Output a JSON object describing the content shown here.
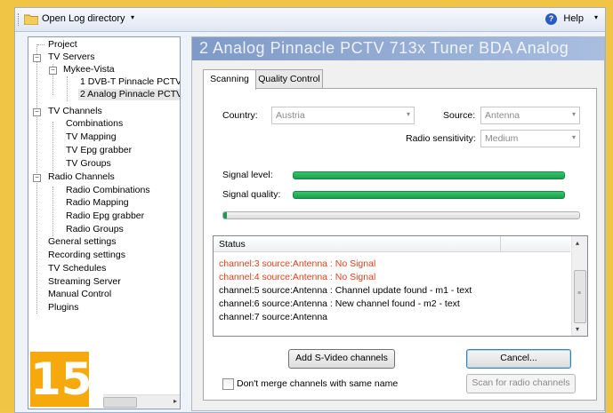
{
  "toolbar": {
    "open_log_label": "Open Log directory",
    "help_label": "Help",
    "caret": "▾"
  },
  "tree": {
    "items": [
      {
        "label": "Project"
      },
      {
        "label": "TV Servers",
        "expander": "−"
      },
      {
        "label": "Mykee-Vista",
        "expander": "−"
      },
      {
        "label": "1 DVB-T Pinnacle PCTV"
      },
      {
        "label": "2 Analog Pinnacle PCTV"
      },
      {
        "label": "TV Channels",
        "expander": "−"
      },
      {
        "label": "Combinations"
      },
      {
        "label": "TV Mapping"
      },
      {
        "label": "TV Epg grabber"
      },
      {
        "label": "TV Groups"
      },
      {
        "label": "Radio Channels",
        "expander": "−"
      },
      {
        "label": "Radio Combinations"
      },
      {
        "label": "Radio Mapping"
      },
      {
        "label": "Radio Epg grabber"
      },
      {
        "label": "Radio Groups"
      },
      {
        "label": "General settings"
      },
      {
        "label": "Recording settings"
      },
      {
        "label": "TV Schedules"
      },
      {
        "label": "Streaming Server"
      },
      {
        "label": "Manual Control"
      },
      {
        "label": "Plugins"
      }
    ]
  },
  "badge": {
    "number": "15"
  },
  "main": {
    "banner_title": "2 Analog Pinnacle PCTV 713x Tuner BDA Analog",
    "tabs": [
      {
        "label": "Scanning"
      },
      {
        "label": "Quality Control"
      }
    ],
    "country_label": "Country:",
    "country_value": "Austria",
    "source_label": "Source:",
    "source_value": "Antenna",
    "radio_sensitivity_label": "Radio sensitivity:",
    "radio_sensitivity_value": "Medium",
    "signal_level_label": "Signal level:",
    "signal_level_fraction": 1.0,
    "signal_quality_label": "Signal quality:",
    "signal_quality_fraction": 1.0,
    "scan_progress_fraction": 0.01,
    "status": {
      "header": "Status",
      "rows": [
        {
          "text": "channel:3 source:Antenna : No Signal",
          "error": true
        },
        {
          "text": "channel:4 source:Antenna : No Signal",
          "error": true
        },
        {
          "text": "channel:5 source:Antenna : Channel update found - m1 - text",
          "error": false
        },
        {
          "text": "channel:6 source:Antenna : New channel found - m2 - text",
          "error": false
        },
        {
          "text": "channel:7 source:Antenna",
          "error": false
        }
      ]
    },
    "add_svideo_label": "Add S-Video channels",
    "cancel_label": "Cancel...",
    "dont_merge_label": "Don't merge channels with same name",
    "scan_radio_label": "Scan for radio channels"
  },
  "colors": {
    "accent_green": "#1d9c4e",
    "error_red": "#e2401c",
    "badge_orange": "#f5a90c"
  }
}
